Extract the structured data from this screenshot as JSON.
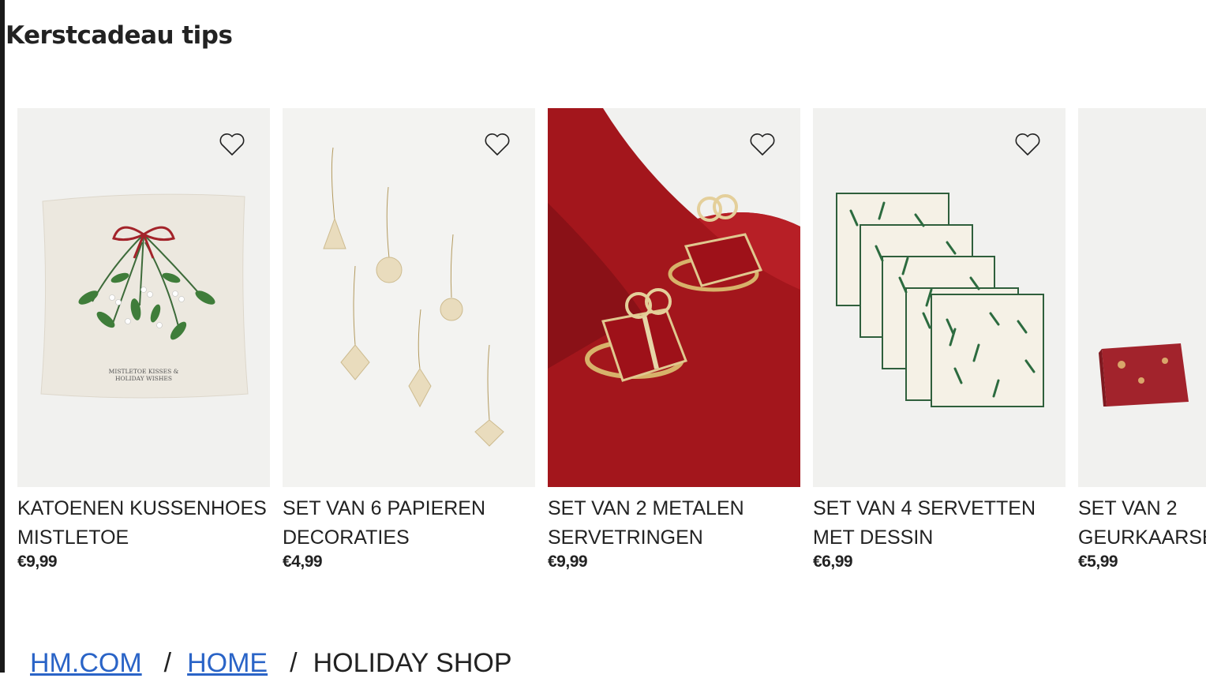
{
  "section": {
    "title": "Kerstcadeau tips"
  },
  "products": [
    {
      "name_line1": "KATOENEN KUSSENHOES",
      "name_line2": "MISTLETOE",
      "price": "€9,99",
      "image_text_1": "MISTLETOE KISSES &",
      "image_text_2": "HOLIDAY WISHES"
    },
    {
      "name_line1": "SET VAN 6 PAPIEREN",
      "name_line2": "DECORATIES",
      "price": "€4,99"
    },
    {
      "name_line1": "SET VAN 2 METALEN",
      "name_line2": "SERVETRINGEN",
      "price": "€9,99"
    },
    {
      "name_line1": "SET VAN 4 SERVETTEN",
      "name_line2": "MET DESSIN",
      "price": "€6,99"
    },
    {
      "name_line1": "SET VAN 2",
      "name_line2": "GEURKAARSEN",
      "price": "€5,99"
    }
  ],
  "breadcrumb": {
    "items": [
      "HM.COM",
      "HOME",
      "HOLIDAY SHOP"
    ],
    "separator": "/"
  },
  "colors": {
    "link": "#2a64c7",
    "text": "#222222",
    "napkin_red": "#a3161c"
  },
  "icons": {
    "favorite": "heart-outline-icon"
  }
}
